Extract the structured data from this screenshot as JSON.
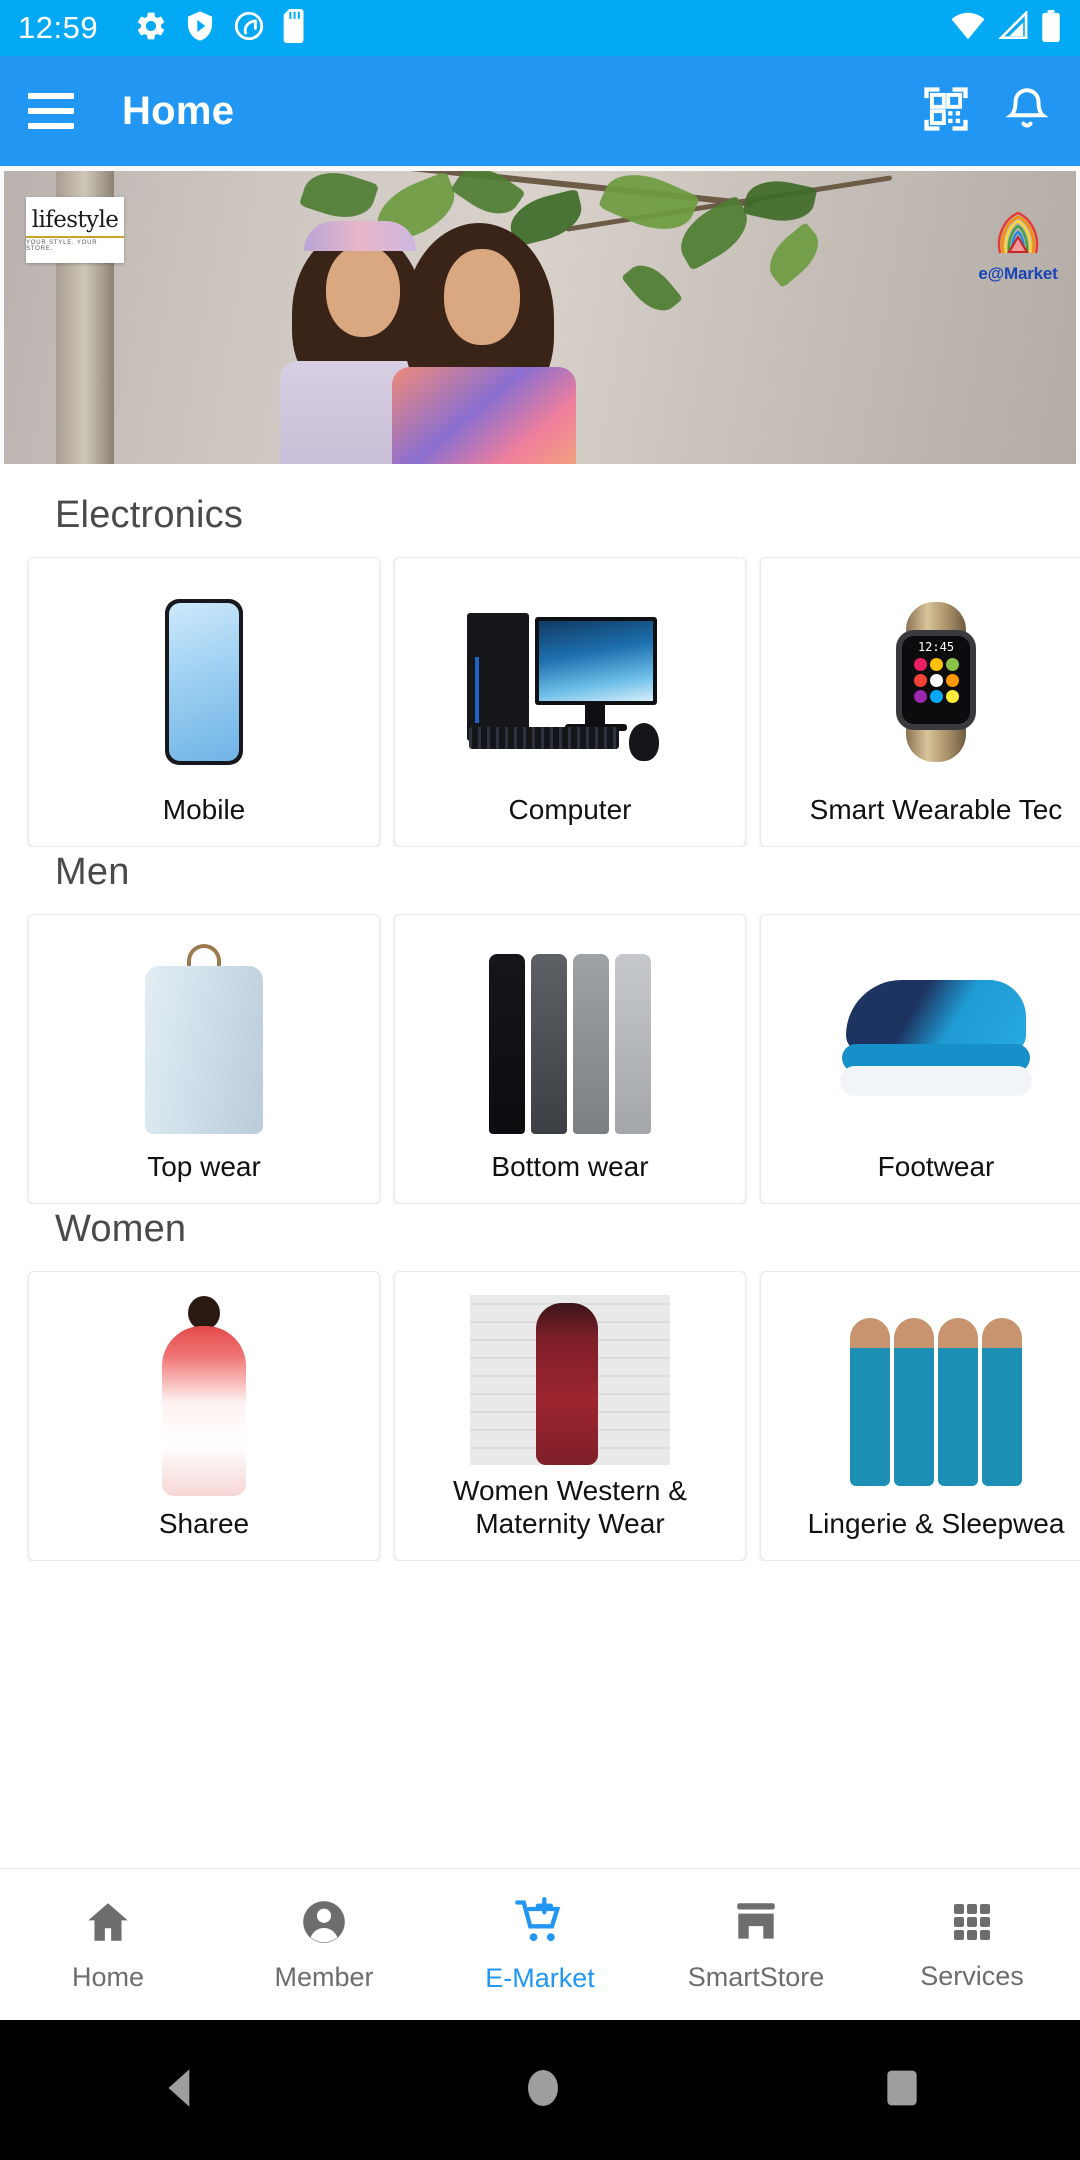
{
  "status_bar": {
    "time": "12:59",
    "left_icons": [
      "gear-icon",
      "shield-play-icon",
      "circle-swirl-icon",
      "sd-card-icon"
    ],
    "right_icons": [
      "wifi-icon",
      "cellular-signal-icon",
      "battery-icon"
    ],
    "background_color": "#03A9F4"
  },
  "app_bar": {
    "title": "Home",
    "menu_icon": "hamburger-menu-icon",
    "actions": [
      "qr-scan-icon",
      "notification-bell-icon"
    ],
    "background_color": "#2196F3"
  },
  "banner": {
    "brand_logo_text": "lifestyle",
    "brand_logo_tagline": "YOUR STYLE. YOUR STORE.",
    "partner_label": "e@Market",
    "partner_label_color": "#1944b8"
  },
  "sections": [
    {
      "title": "Electronics",
      "cards": [
        {
          "label": "Mobile",
          "image": "smartphone-image"
        },
        {
          "label": "Computer",
          "image": "desktop-computer-image"
        },
        {
          "label": "Smart Wearable Tec",
          "image": "smartwatch-image"
        }
      ]
    },
    {
      "title": "Men",
      "cards": [
        {
          "label": "Top wear",
          "image": "mens-shirt-image"
        },
        {
          "label": "Bottom wear",
          "image": "mens-trousers-image"
        },
        {
          "label": "Footwear",
          "image": "sneaker-image"
        }
      ]
    },
    {
      "title": "Women",
      "cards": [
        {
          "label": "Sharee",
          "image": "saree-image"
        },
        {
          "label": "Women Western & Maternity Wear",
          "image": "maternity-gown-image"
        },
        {
          "label": "Lingerie & Sleepwea",
          "image": "lingerie-sleepwear-image"
        }
      ]
    }
  ],
  "bottom_nav": {
    "active_color": "#2196F3",
    "inactive_color": "#6d6d6d",
    "items": [
      {
        "label": "Home",
        "icon": "home-icon",
        "active": false
      },
      {
        "label": "Member",
        "icon": "person-icon",
        "active": false
      },
      {
        "label": "E-Market",
        "icon": "shopping-cart-plus-icon",
        "active": true
      },
      {
        "label": "SmartStore",
        "icon": "storefront-icon",
        "active": false
      },
      {
        "label": "Services",
        "icon": "apps-grid-icon",
        "active": false
      }
    ]
  },
  "android_nav": {
    "buttons": [
      "back-triangle-icon",
      "home-circle-icon",
      "recents-square-icon"
    ]
  }
}
